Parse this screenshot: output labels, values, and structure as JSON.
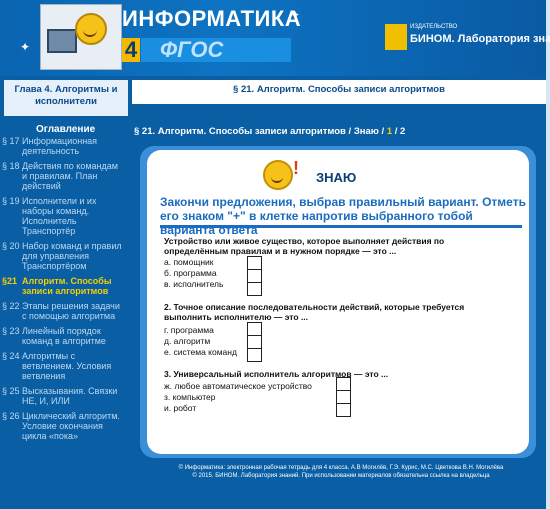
{
  "header": {
    "title": "ИНФОРМАТИКА",
    "grade": "4",
    "fgos": "ФГОС",
    "publisher_small": "ИЗДАТЕЛЬСТВО",
    "publisher": "БИНОМ. Лаборатория знаний"
  },
  "sidebar": {
    "chapter": "Глава 4. Алгоритмы и исполнители",
    "toc_title": "Оглавление",
    "items": [
      {
        "num": "§ 17",
        "label": "Информационная деятельность"
      },
      {
        "num": "§ 18",
        "label": "Действия по командам и правилам. План действий"
      },
      {
        "num": "§ 19",
        "label": "Исполнители и их наборы команд. Исполнитель Транспортёр"
      },
      {
        "num": "§ 20",
        "label": "Набор команд и правил для управления Транспортёром"
      },
      {
        "num": "§21",
        "label": "Алгоритм. Способы записи алгоритмов",
        "active": true
      },
      {
        "num": "§ 22",
        "label": "Этапы решения задачи с помощью алгоритма"
      },
      {
        "num": "§ 23",
        "label": "Линейный порядок команд в алгоритме"
      },
      {
        "num": "§ 24",
        "label": "Алгоритмы с ветвлением. Условия ветвления"
      },
      {
        "num": "§ 25",
        "label": "Высказывания. Связки НЕ, И, ИЛИ"
      },
      {
        "num": "§ 26",
        "label": "Циклический алгоритм. Условие окончания цикла «пока»"
      }
    ]
  },
  "main": {
    "section_title": "§ 21. Алгоритм. Способы записи алгоритмов",
    "breadcrumb_text": "§ 21. Алгоритм. Способы записи алгоритмов / Знаю /",
    "page_1": "1",
    "page_sep": "/",
    "page_2": "2",
    "know_heading": "ЗНАЮ",
    "task": "Закончи предложения, выбрав правильный вариант. Отметь его знаком \"+\" в клетке напротив выбранного тобой варианта ответа",
    "questions": [
      {
        "text": "Устройство или живое существо, которое выполняет действия по определённым правилам и в нужном порядке — это ...",
        "options": [
          "а. помощник",
          "б. программа",
          "в. исполнитель"
        ]
      },
      {
        "text": "2. Точное описание последовательности действий, которые требуется выполнить исполнителю — это ...",
        "options": [
          "г. программа",
          "д. алгоритм",
          "е. система команд"
        ]
      },
      {
        "text": "3. Универсальный исполнитель алгоритмов — это ...",
        "options": [
          "ж. любое автоматическое устройство",
          "з. компьютер",
          "и. робот"
        ]
      }
    ]
  },
  "footer": {
    "line1": "© Информатика: электронная рабочая тетрадь для 4 класса. А.В Могилёв, Г.Э. Курис, М.С. Цветкова В.Н. Могилёва",
    "line2": "© 2015. БИНОМ. Лаборатория знаний. При использовании материалов обязательна ссылка на владельца"
  }
}
